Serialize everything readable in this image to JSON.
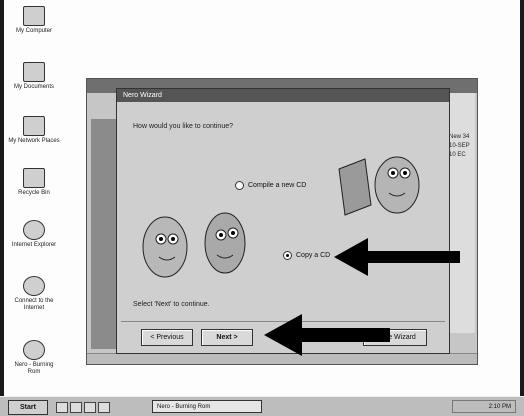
{
  "desktop_icons": [
    {
      "label": "My Computer"
    },
    {
      "label": "My Documents"
    },
    {
      "label": "My Network Places"
    },
    {
      "label": "Recycle Bin"
    },
    {
      "label": "Internet Explorer"
    },
    {
      "label": "Connect to the Internet"
    },
    {
      "label": "Nero - Burning Rom"
    }
  ],
  "bg_window": {
    "right_rows": [
      "New 34",
      "10-SEP",
      "10 EC",
      "",
      ""
    ]
  },
  "wizard": {
    "title": "Nero Wizard",
    "question": "How would you like to continue?",
    "option1": "Compile a new CD",
    "option2": "Copy a CD",
    "hint": "Select 'Next' to continue.",
    "prev_button": "< Previous",
    "next_button": "Next >",
    "close_button": "Close Wizard"
  },
  "taskbar": {
    "start": "Start",
    "task_item": "Nero - Burning Rom",
    "clock": "2:10 PM"
  }
}
